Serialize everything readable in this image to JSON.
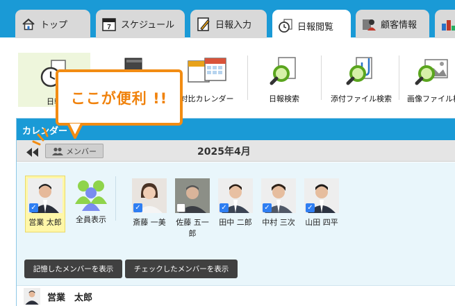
{
  "tabs": [
    {
      "label": "トップ",
      "icon": "house-icon",
      "active": false
    },
    {
      "label": "スケジュール",
      "icon": "calendar-7-icon",
      "active": false
    },
    {
      "label": "日報入力",
      "icon": "pencil-document-icon",
      "active": false
    },
    {
      "label": "日報閲覧",
      "icon": "clock-document-icon",
      "active": true
    },
    {
      "label": "顧客情報",
      "icon": "customer-icon",
      "active": false
    },
    {
      "label": "",
      "icon": "chart-icon",
      "active": false
    }
  ],
  "toolbar": {
    "items": [
      {
        "label": "日報",
        "icon": "clock-report-icon",
        "selected": true
      },
      {
        "label": "",
        "icon": "book-icon",
        "selected": false
      },
      {
        "label": "対比カレンダー",
        "icon": "compare-calendar-icon",
        "selected": false
      },
      {
        "label": "日報検索",
        "icon": "report-search-icon",
        "selected": false
      },
      {
        "label": "添付ファイル検索",
        "icon": "attachment-search-icon",
        "selected": false
      },
      {
        "label": "画像ファイル検",
        "icon": "image-search-icon",
        "selected": false
      }
    ]
  },
  "callout": {
    "text": "ここが便利 !!"
  },
  "calendar": {
    "title": "カレンダー",
    "member_button": "メンバー",
    "month": "2025年4月",
    "members": [
      {
        "name": "営業 太郎",
        "checked": true,
        "self": true
      },
      {
        "name": "全員表示",
        "checked": false,
        "group": true
      },
      {
        "name": "斎藤 一美",
        "checked": true
      },
      {
        "name": "佐藤 五一郎",
        "checked": false
      },
      {
        "name": "田中 二郎",
        "checked": true
      },
      {
        "name": "中村 三次",
        "checked": true
      },
      {
        "name": "山田 四平",
        "checked": true
      }
    ],
    "buttons": {
      "show_remembered": "記憶したメンバーを表示",
      "show_checked": "チェックしたメンバーを表示"
    },
    "current_user": "営業　太郎"
  },
  "colors": {
    "tab_bar": "#1a9ad6",
    "callout": "#f28c13",
    "check": "#2f7ef2",
    "selected_member": "#fff7a8"
  }
}
